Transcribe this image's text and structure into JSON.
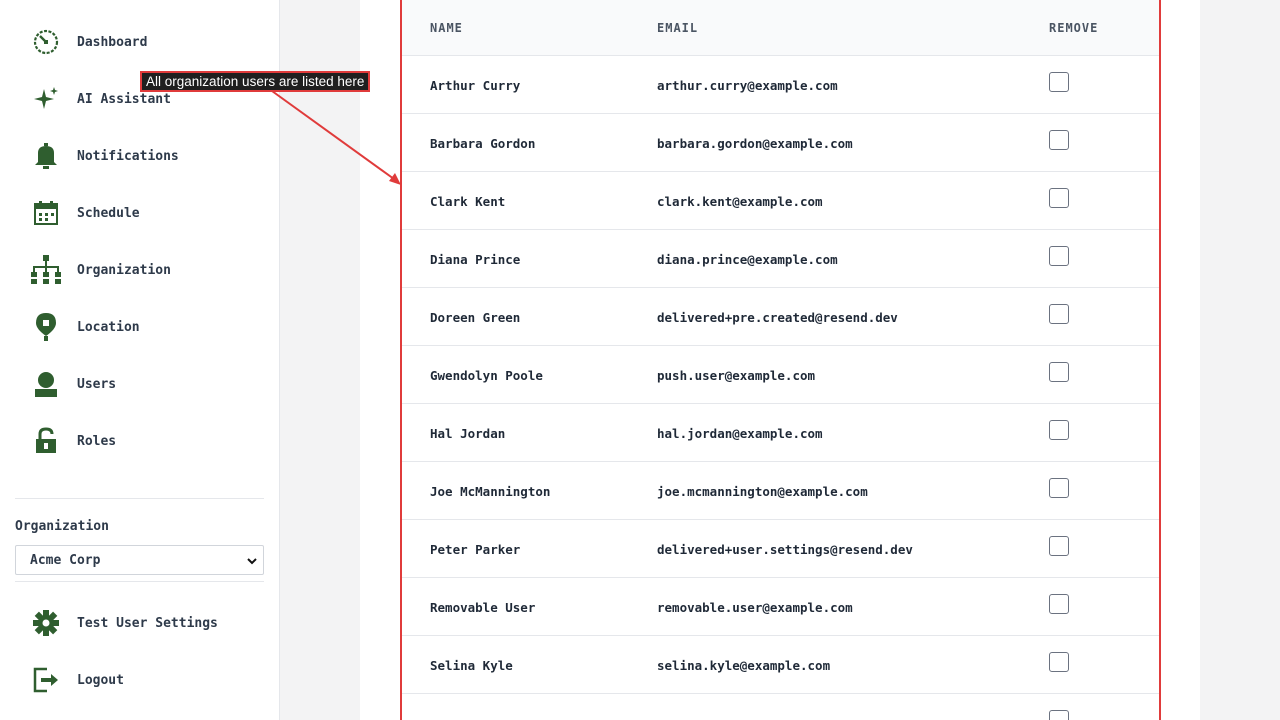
{
  "sidebar": {
    "items": [
      {
        "label": "Dashboard",
        "icon": "dashboard-icon"
      },
      {
        "label": "AI Assistant",
        "icon": "sparkle-icon"
      },
      {
        "label": "Notifications",
        "icon": "bell-icon"
      },
      {
        "label": "Schedule",
        "icon": "calendar-icon"
      },
      {
        "label": "Organization",
        "icon": "org-chart-icon"
      },
      {
        "label": "Location",
        "icon": "location-pin-icon"
      },
      {
        "label": "Users",
        "icon": "user-icon"
      },
      {
        "label": "Roles",
        "icon": "lock-icon"
      }
    ],
    "organization_label": "Organization",
    "organization_selected": "Acme Corp",
    "bottom_items": [
      {
        "label": "Test User Settings",
        "icon": "gear-icon"
      },
      {
        "label": "Logout",
        "icon": "logout-icon"
      }
    ]
  },
  "annotation": {
    "text": "All organization users are listed here"
  },
  "table": {
    "columns": [
      "NAME",
      "EMAIL",
      "REMOVE"
    ],
    "rows": [
      {
        "name": "Arthur Curry",
        "email": "arthur.curry@example.com"
      },
      {
        "name": "Barbara Gordon",
        "email": "barbara.gordon@example.com"
      },
      {
        "name": "Clark Kent",
        "email": "clark.kent@example.com"
      },
      {
        "name": "Diana Prince",
        "email": "diana.prince@example.com"
      },
      {
        "name": "Doreen Green",
        "email": "delivered+pre.created@resend.dev"
      },
      {
        "name": "Gwendolyn Poole",
        "email": "push.user@example.com"
      },
      {
        "name": "Hal Jordan",
        "email": "hal.jordan@example.com"
      },
      {
        "name": "Joe McMannington",
        "email": "joe.mcmannington@example.com"
      },
      {
        "name": "Peter Parker",
        "email": "delivered+user.settings@resend.dev"
      },
      {
        "name": "Removable User",
        "email": "removable.user@example.com"
      },
      {
        "name": "Selina Kyle",
        "email": "selina.kyle@example.com"
      }
    ]
  },
  "colors": {
    "icon_green": "#2f5e2f",
    "annotation_red": "#e03b3b"
  }
}
